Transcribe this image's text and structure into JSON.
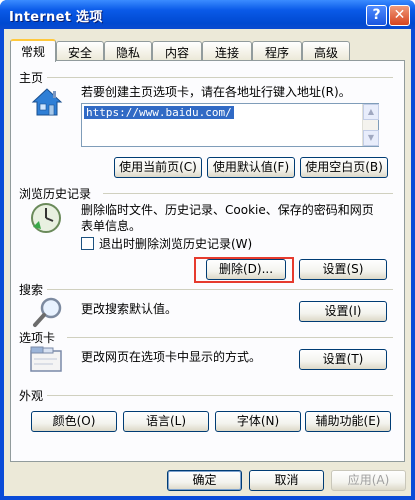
{
  "window": {
    "title": "Internet 选项",
    "help_label": "?",
    "close_label": "✕"
  },
  "tabs": [
    "常规",
    "安全",
    "隐私",
    "内容",
    "连接",
    "程序",
    "高级"
  ],
  "home": {
    "title": "主页",
    "description": "若要创建主页选项卡，请在各地址行键入地址(R)。",
    "url": "https://www.baidu.com/",
    "use_current": "使用当前页(C)",
    "use_default": "使用默认值(F)",
    "use_blank": "使用空白页(B)"
  },
  "history": {
    "title": "浏览历史记录",
    "description_line1": "删除临时文件、历史记录、Cookie、保存的密码和网页",
    "description_line2": "表单信息。",
    "checkbox_label": "退出时删除浏览历史记录(W)",
    "checkbox_checked": false,
    "delete_label": "删除(D)...",
    "settings_label": "设置(S)"
  },
  "search": {
    "title": "搜索",
    "description": "更改搜索默认值。",
    "settings_label": "设置(I)"
  },
  "tabs_section": {
    "title": "选项卡",
    "description": "更改网页在选项卡中显示的方式。",
    "settings_label": "设置(T)"
  },
  "appearance": {
    "title": "外观",
    "colors_label": "颜色(O)",
    "languages_label": "语言(L)",
    "fonts_label": "字体(N)",
    "accessibility_label": "辅助功能(E)"
  },
  "footer": {
    "ok_label": "确定",
    "cancel_label": "取消",
    "apply_label": "应用(A)"
  },
  "colors": {
    "titlebar": "#0a5ae8",
    "dialog_bg": "#ece9d8",
    "highlight_box": "#e63b2e"
  }
}
